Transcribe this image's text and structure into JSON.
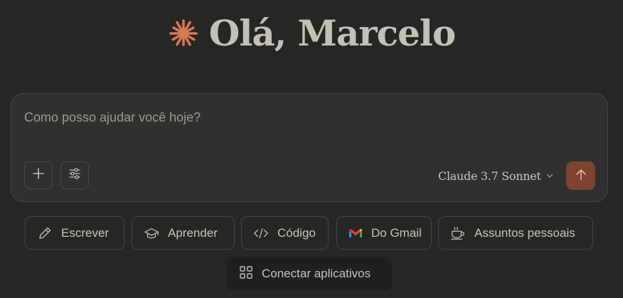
{
  "greeting": {
    "text": "Olá, Marcelo",
    "logo_icon": "claude-starburst-icon",
    "logo_color": "#d97757"
  },
  "composer": {
    "placeholder": "Como posso ajudar você hoje?",
    "value": "",
    "add_icon": "plus-icon",
    "tools_icon": "sliders-icon",
    "model": "Claude 3.7 Sonnet",
    "send_icon": "arrow-up-icon",
    "send_color": "#7c4330"
  },
  "actions": [
    {
      "label": "Escrever",
      "icon": "pencil-icon"
    },
    {
      "label": "Aprender",
      "icon": "graduation-cap-icon"
    },
    {
      "label": "Código",
      "icon": "code-icon"
    },
    {
      "label": "Do Gmail",
      "icon": "gmail-icon"
    },
    {
      "label": "Assuntos pessoais",
      "icon": "coffee-cup-icon"
    }
  ],
  "connect": {
    "label": "Conectar aplicativos",
    "icon": "grid-icon"
  },
  "colors": {
    "background": "#262624",
    "surface": "#30302e",
    "text": "#c2c0b6",
    "accent": "#d97757"
  }
}
